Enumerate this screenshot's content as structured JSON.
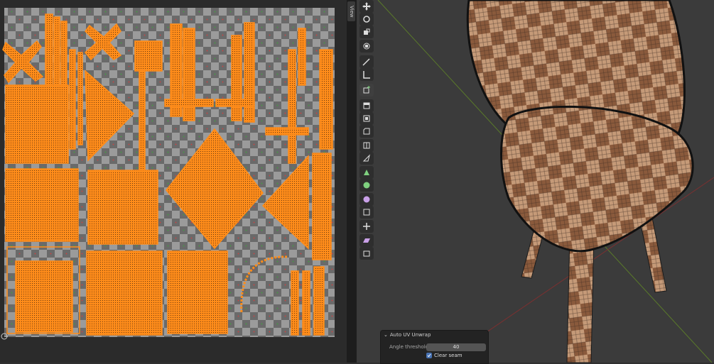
{
  "header": {
    "view_tab_label": "View"
  },
  "operator_panel": {
    "title": "Auto UV Unwrap",
    "angle_threshold_label": "Angle threshold",
    "angle_threshold_value": "40",
    "clear_seam_label": "Clear seam",
    "clear_seam_checked": true
  },
  "toolbar": {
    "icons": [
      "move-icon",
      "rotate-icon",
      "scale-icon",
      "transform-icon",
      "annotate-icon",
      "measure-icon",
      "add-cube-icon",
      "extrude-icon",
      "inset-icon",
      "bevel-icon",
      "loop-cut-icon",
      "knife-icon",
      "poly-build-icon",
      "spin-icon",
      "smooth-icon",
      "edge-slide-icon",
      "shrink-fatten-icon",
      "shear-icon",
      "rip-region-icon"
    ],
    "active_icon": "add-cube-icon"
  },
  "colors": {
    "uv_wire": "#ff8c1a",
    "checker_light": "#9b9b9b",
    "checker_dark": "#6a6a6a",
    "viewport_bg": "#3b3b3b",
    "chair_light": "#c59a78",
    "chair_dark": "#8a5a3c",
    "checkbox_blue": "#4772b3"
  }
}
